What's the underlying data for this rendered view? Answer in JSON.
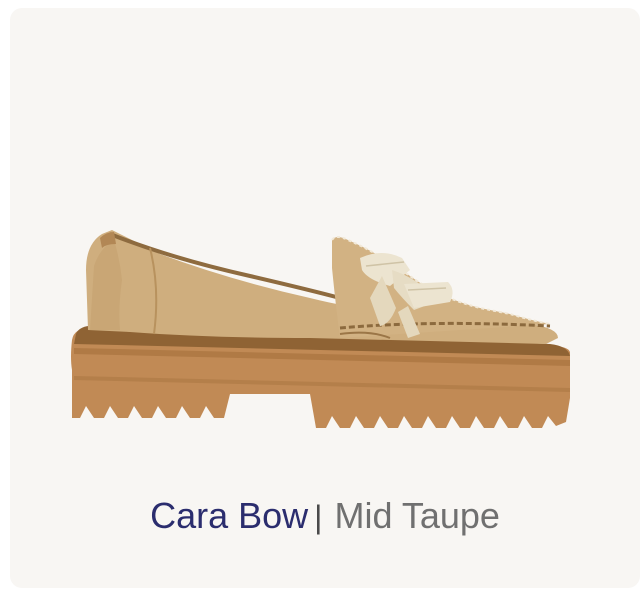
{
  "product": {
    "name": "Cara Bow",
    "separator": "|",
    "color_name": "Mid Taupe",
    "image_alt": "Cara Bow loafer in Mid Taupe",
    "image_icon": "shoe-image"
  },
  "colors": {
    "card_background": "#f8f6f3",
    "name_text": "#2b2d6e",
    "color_text": "#707070",
    "upper": "#cfae7e",
    "sole": "#c18a55",
    "bow": "#ece4d0"
  }
}
